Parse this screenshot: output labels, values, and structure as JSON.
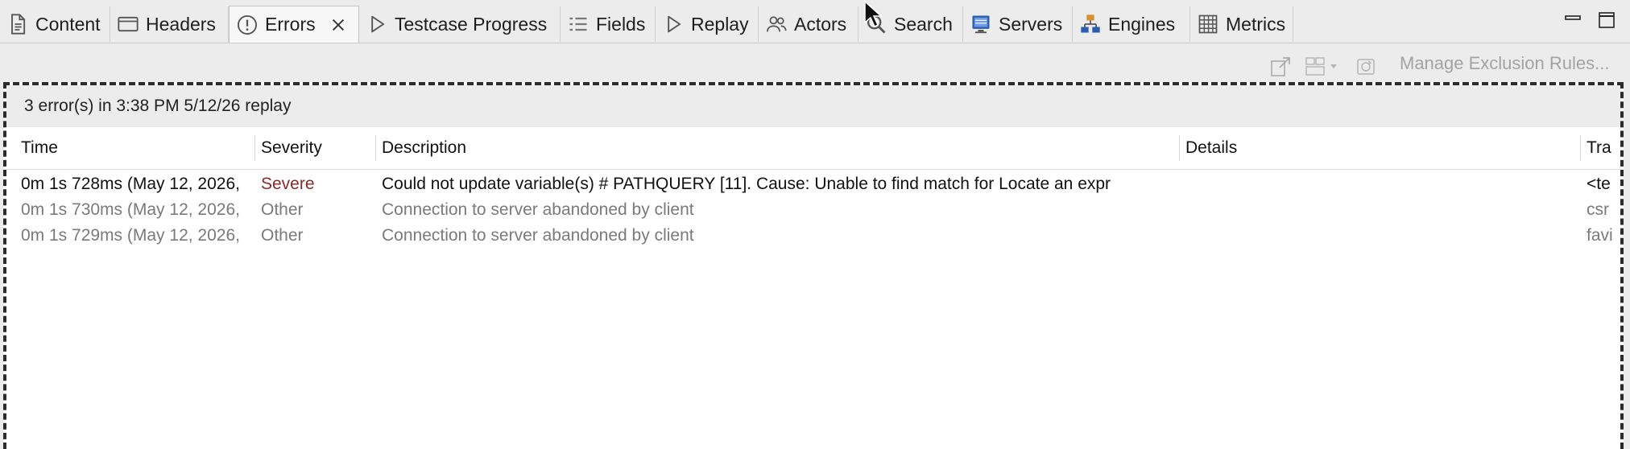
{
  "tabs": [
    {
      "label": "Content",
      "icon": "document-icon"
    },
    {
      "label": "Headers",
      "icon": "window-icon"
    },
    {
      "label": "Errors",
      "icon": "error-circle-icon",
      "active": true
    },
    {
      "label": "Testcase Progress",
      "icon": "play-outline-icon"
    },
    {
      "label": "Fields",
      "icon": "list-icon"
    },
    {
      "label": "Replay",
      "icon": "play-outline-icon"
    },
    {
      "label": "Actors",
      "icon": "users-icon"
    },
    {
      "label": "Search",
      "icon": "search-icon"
    },
    {
      "label": "Servers",
      "icon": "monitor-icon"
    },
    {
      "label": "Engines",
      "icon": "hierarchy-icon"
    },
    {
      "label": "Metrics",
      "icon": "grid-icon"
    }
  ],
  "toolbar": {
    "manage_label": "Manage Exclusion Rules..."
  },
  "status_text": "3 error(s) in 3:38 PM 5/12/26 replay",
  "columns": [
    "Time",
    "Severity",
    "Description",
    "Details",
    "Tra"
  ],
  "rows": [
    {
      "time": "0m 1s 728ms (May 12, 2026,",
      "severity": "Severe",
      "description": "Could not update variable(s) # PATHQUERY [11]. Cause: Unable to find match for Locate an expr",
      "details": "",
      "trace": "<te"
    },
    {
      "time": "0m 1s 730ms (May 12, 2026,",
      "severity": "Other",
      "description": "Connection to server abandoned by client",
      "details": "",
      "trace": "csr"
    },
    {
      "time": "0m 1s 729ms (May 12, 2026,",
      "severity": "Other",
      "description": "Connection to server abandoned by client",
      "details": "",
      "trace": "favi"
    }
  ],
  "colors": {
    "severe": "#8b2a2a",
    "muted": "#7a7a7a",
    "accent_blue": "#2a5db0",
    "engine_orange": "#d9902a"
  }
}
